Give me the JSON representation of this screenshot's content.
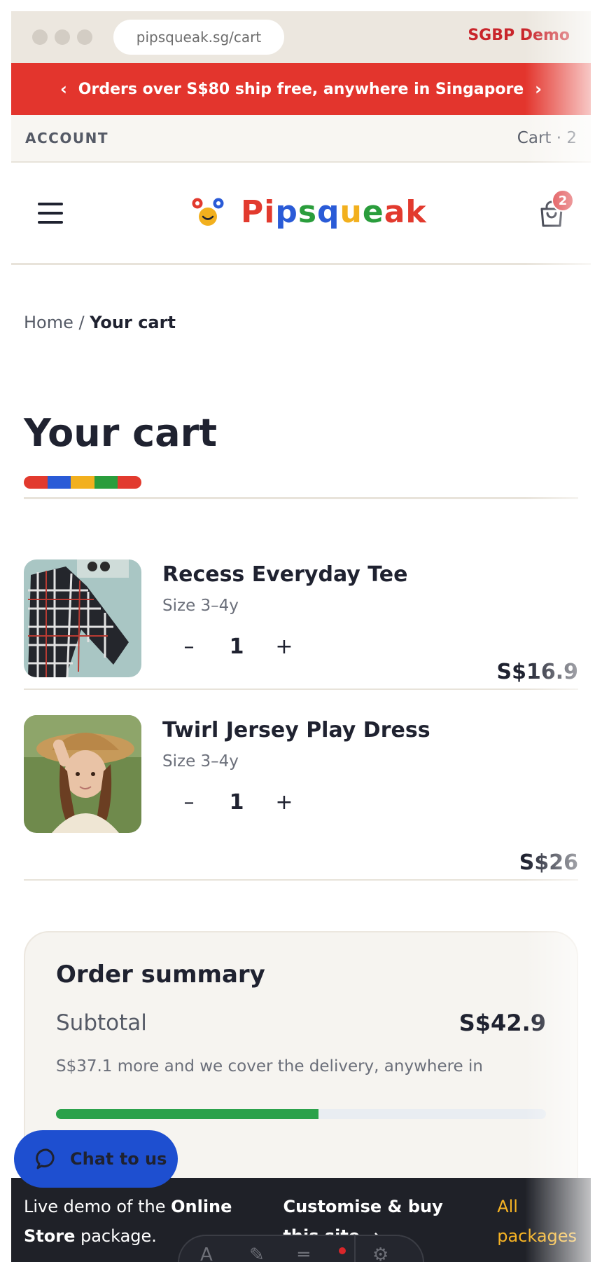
{
  "browser": {
    "url": "pipsqueak.sg/cart",
    "demo_label": "SGBP Demo"
  },
  "promo": {
    "prev": "‹",
    "text": "Orders over S$80 ship free, anywhere in Singapore",
    "next": "›"
  },
  "utility": {
    "account": "ACCOUNT",
    "cart": "Cart · 2"
  },
  "header": {
    "logo_letters": [
      {
        "char": "P",
        "color": "#e23a2e"
      },
      {
        "char": "i",
        "color": "#e23a2e"
      },
      {
        "char": "p",
        "color": "#2a5bd7"
      },
      {
        "char": "s",
        "color": "#2a9d3c"
      },
      {
        "char": "q",
        "color": "#2a5bd7"
      },
      {
        "char": "u",
        "color": "#f2b01e"
      },
      {
        "char": "e",
        "color": "#2a9d3c"
      },
      {
        "char": "a",
        "color": "#e23a2e"
      },
      {
        "char": "k",
        "color": "#e23a2e"
      }
    ],
    "cart_badge": "2"
  },
  "breadcrumb": {
    "home": "Home",
    "separator": "/",
    "current": "Your cart"
  },
  "page_title": "Your cart",
  "rainbow_colors": [
    "#e23a2e",
    "#2a5bd7",
    "#f2b01e",
    "#2a9d3c",
    "#e23a2e"
  ],
  "cart_items": [
    {
      "name": "Recess Everyday Tee",
      "size": "Size 3–4y",
      "quantity": "1",
      "price": "S$16.9",
      "minus": "–",
      "plus": "+"
    },
    {
      "name": "Twirl Jersey Play Dress",
      "size": "Size 3–4y",
      "quantity": "1",
      "price": "S$26",
      "minus": "–",
      "plus": "+"
    }
  ],
  "summary": {
    "title": "Order summary",
    "subtotal_label": "Subtotal",
    "subtotal_value": "S$42.9",
    "shipping_note": "S$37.1 more and we cover the delivery, anywhere in",
    "progress_fraction": 0.536
  },
  "chat": {
    "label": "Chat to us"
  },
  "demo_bar": {
    "text_prefix": "Live demo of the ",
    "text_bold": "Online Store",
    "text_suffix": " package.",
    "cta": "Customise & buy this site →",
    "all_packages": "All packages"
  },
  "icons": [
    "hamburger-icon",
    "bag-icon",
    "chat-bubble-icon",
    "minus-icon",
    "plus-icon"
  ]
}
